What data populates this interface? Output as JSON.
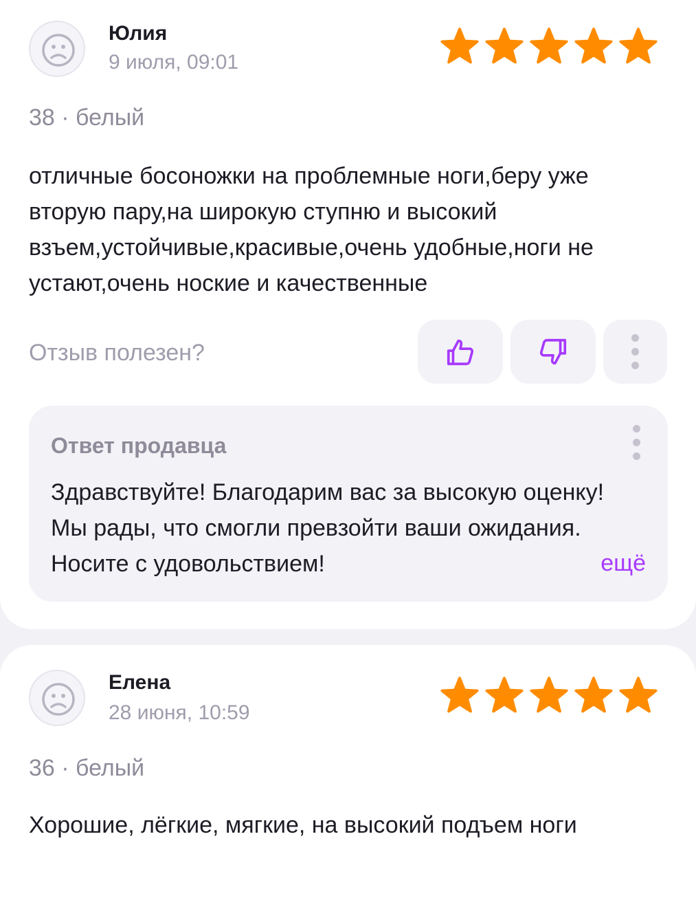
{
  "colors": {
    "star": "#ff8c00",
    "accent": "#a73afd",
    "muted": "#a09cac",
    "page_bg": "#f2f1f6"
  },
  "reviews": [
    {
      "author": "Юлия",
      "date": "9 июля, 09:01",
      "rating": 5,
      "rating_max": 5,
      "variant": "38 · белый",
      "text": "отличные босоножки на проблемные ноги,беру уже вторую пару,на широкую ступню и высокий взъем,устойчивые,красивые,очень удобные,ноги не устают,очень ноские и качественные",
      "helpful_label": "Отзыв полезен?",
      "icons": {
        "avatar": "sad-face-icon",
        "like": "thumbs-up-icon",
        "dislike": "thumbs-down-icon",
        "menu": "more-vertical-icon"
      },
      "seller_reply": {
        "title": "Ответ продавца",
        "text": "Здравствуйте! Благодарим вас за высокую оценку! Мы рады, что смогли превзойти ваши ожидания. Носите с удовольствием!",
        "more_label": "ещё"
      }
    },
    {
      "author": "Елена",
      "date": "28 июня, 10:59",
      "rating": 5,
      "rating_max": 5,
      "variant": "36 · белый",
      "text": "Хорошие,  лёгкие,  мягкие, на высокий подъем ноги",
      "icons": {
        "avatar": "sad-face-icon"
      }
    }
  ]
}
